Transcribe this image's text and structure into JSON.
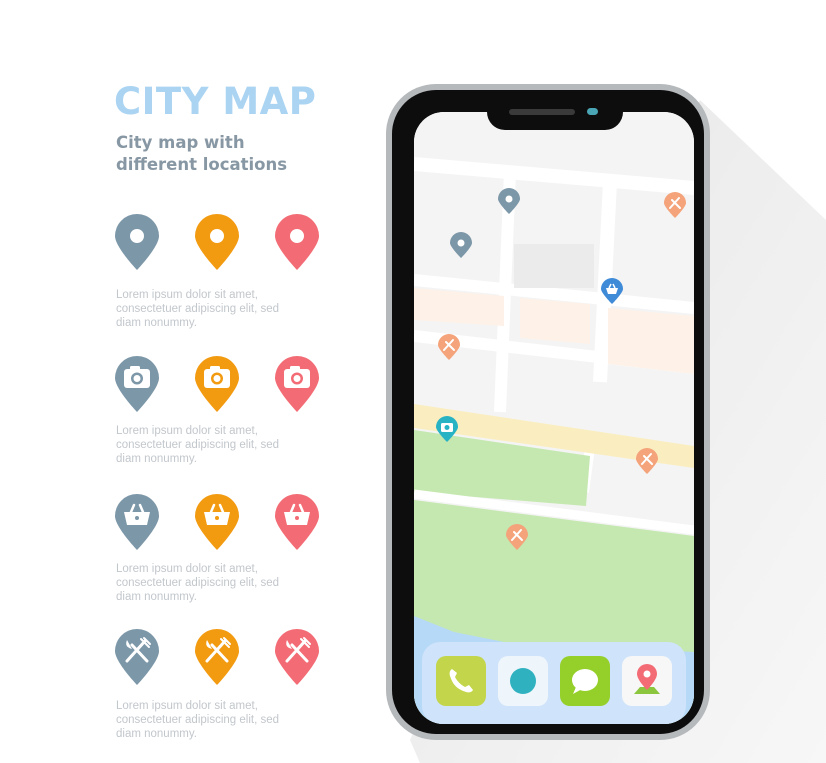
{
  "header": {
    "title": "CITY MAP",
    "subtitle_line1": "City map with",
    "subtitle_line2": "different locations"
  },
  "colors": {
    "slate": "#7c97a8",
    "orange": "#f29a10",
    "coral": "#f36b74",
    "title": "#aad4f2",
    "map_pin_orange": "#f4a37a",
    "map_pin_blue": "#3f8bd8",
    "map_pin_teal": "#27b3c4",
    "park": "#c5e8b0",
    "water": "#b6d9f7",
    "road_yellow": "#faeec0"
  },
  "legend": {
    "rows": [
      {
        "icon": "location-dot-icon",
        "text": [
          "Lorem ipsum dolor sit amet,",
          "consectetuer adipiscing elit, sed",
          "diam nonummy."
        ]
      },
      {
        "icon": "camera-icon",
        "text": [
          "Lorem ipsum dolor sit amet,",
          "consectetuer adipiscing elit, sed",
          "diam nonummy."
        ]
      },
      {
        "icon": "shopping-basket-icon",
        "text": [
          "Lorem ipsum dolor sit amet,",
          "consectetuer adipiscing elit, sed",
          "diam nonummy."
        ]
      },
      {
        "icon": "fork-knife-icon",
        "text": [
          "Lorem ipsum dolor sit amet,",
          "consectetuer adipiscing elit, sed",
          "diam nonummy."
        ]
      }
    ]
  },
  "phone": {
    "dock_apps": [
      "phone-app-icon",
      "circle-app-icon",
      "messages-app-icon",
      "maps-app-icon"
    ]
  }
}
